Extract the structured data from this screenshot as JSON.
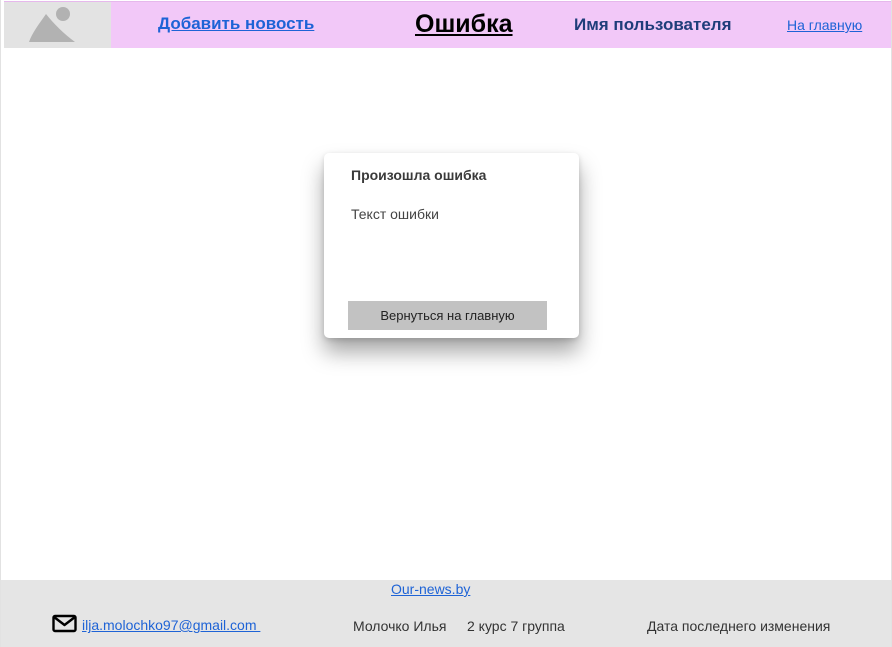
{
  "header": {
    "logo_icon": "image-placeholder-icon",
    "add_news_label": "Добавить новость",
    "title": "Ошибка",
    "user_name": "Имя пользователя",
    "home_label": "На главную"
  },
  "dialog": {
    "title": "Произошла ошибка",
    "message": "Текст ошибки",
    "button_label": "Вернуться на главную"
  },
  "footer": {
    "site_link": "Our-news.by",
    "mail_icon": "envelope-icon",
    "email": "ilja.molochko97@gmail.com ",
    "author": "Молочко Илья",
    "group": "2 курс 7 группа",
    "last_modified": "Дата последнего изменения"
  },
  "colors": {
    "header_bg": "#f2c8f8",
    "logo_bg": "#e3e3e3",
    "link": "#1e63d6",
    "user_name": "#1f3d7a",
    "footer_bg": "#e5e5e5",
    "button_bg": "#c2c2c2"
  }
}
